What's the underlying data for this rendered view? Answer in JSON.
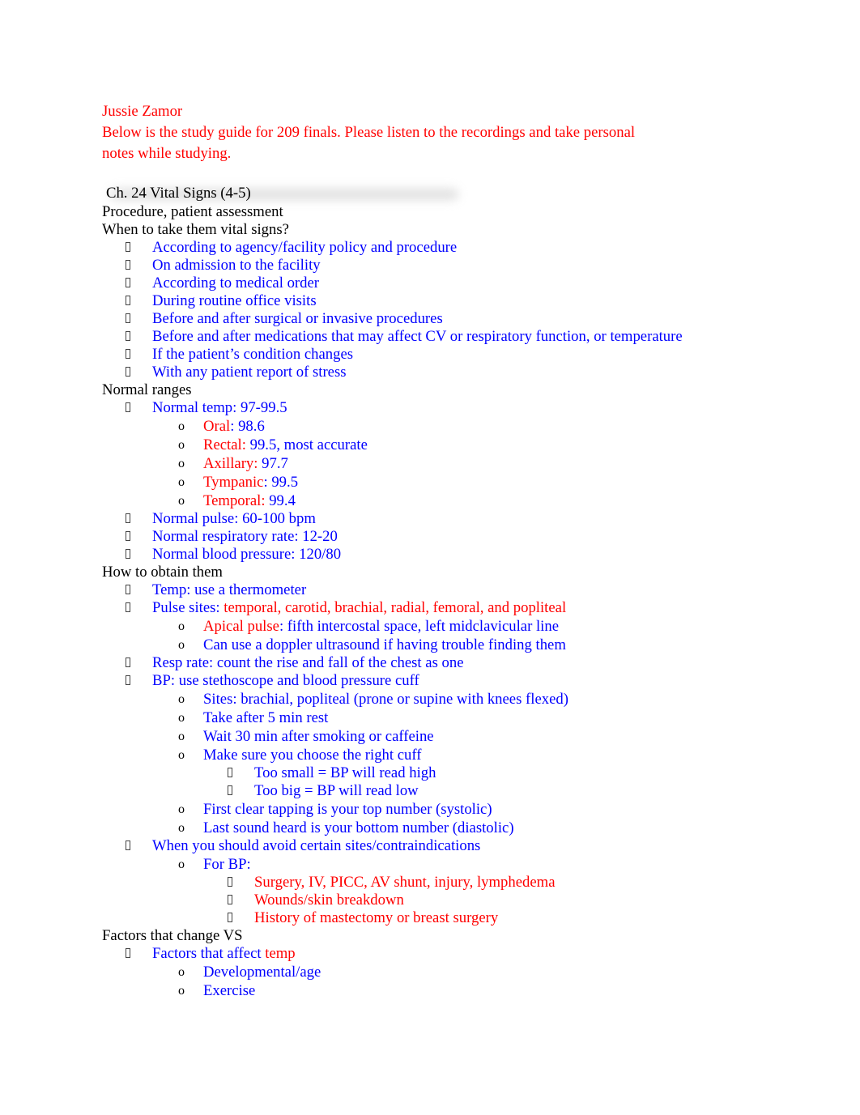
{
  "author": "Jussie Zamor",
  "intro": {
    "line1": "Below is the study guide for 209 finals. Please listen to the recordings and take personal",
    "line2": "notes while studying."
  },
  "colors": {
    "red": "#ff0000",
    "blue": "#0000ff",
    "black": "#000000"
  },
  "bullet_icons": {
    "level1": "missing-glyph-box",
    "level2": "o",
    "level3": "missing-glyph-box"
  },
  "chapter_heading": "Ch. 24 Vital Signs (4-5)",
  "lines": [
    {
      "level": 0,
      "segments": [
        {
          "text": "Procedure, patient assessment",
          "color": "black"
        }
      ]
    },
    {
      "level": 0,
      "segments": [
        {
          "text": "When to take them vital signs?",
          "color": "black"
        }
      ]
    },
    {
      "level": 1,
      "segments": [
        {
          "text": "According to agency/facility policy and procedure",
          "color": "blue"
        }
      ]
    },
    {
      "level": 1,
      "segments": [
        {
          "text": "On admission to the facility",
          "color": "blue"
        }
      ]
    },
    {
      "level": 1,
      "segments": [
        {
          "text": "According to medical order",
          "color": "blue"
        }
      ]
    },
    {
      "level": 1,
      "segments": [
        {
          "text": "During routine office visits",
          "color": "blue"
        }
      ]
    },
    {
      "level": 1,
      "segments": [
        {
          "text": "Before and after surgical or invasive procedures",
          "color": "blue"
        }
      ]
    },
    {
      "level": 1,
      "segments": [
        {
          "text": "Before and after medications that may affect CV or respiratory function, or temperature",
          "color": "blue"
        }
      ]
    },
    {
      "level": 1,
      "segments": [
        {
          "text": "If the patient’s condition changes",
          "color": "blue"
        }
      ]
    },
    {
      "level": 1,
      "segments": [
        {
          "text": "With any patient report of stress",
          "color": "blue"
        }
      ]
    },
    {
      "level": 0,
      "segments": [
        {
          "text": "Normal ranges",
          "color": "black"
        }
      ]
    },
    {
      "level": 1,
      "segments": [
        {
          "text": "Normal temp: 97-99.5",
          "color": "blue"
        }
      ]
    },
    {
      "level": 2,
      "segments": [
        {
          "text": "Oral",
          "color": "red"
        },
        {
          "text": ": 98.6",
          "color": "blue"
        }
      ]
    },
    {
      "level": 2,
      "segments": [
        {
          "text": "Rectal:",
          "color": "red"
        },
        {
          "text": " 99.5, most accurate",
          "color": "blue"
        }
      ]
    },
    {
      "level": 2,
      "segments": [
        {
          "text": "Axillary:",
          "color": "red"
        },
        {
          "text": " 97.7",
          "color": "blue"
        }
      ]
    },
    {
      "level": 2,
      "segments": [
        {
          "text": "Tympanic",
          "color": "red"
        },
        {
          "text": ": 99.5",
          "color": "blue"
        }
      ]
    },
    {
      "level": 2,
      "segments": [
        {
          "text": "Temporal:",
          "color": "red"
        },
        {
          "text": " 99.4",
          "color": "blue"
        }
      ]
    },
    {
      "level": 1,
      "segments": [
        {
          "text": "Normal pulse: 60-100 bpm",
          "color": "blue"
        }
      ]
    },
    {
      "level": 1,
      "segments": [
        {
          "text": "Normal respiratory rate: 12-20",
          "color": "blue"
        }
      ]
    },
    {
      "level": 1,
      "segments": [
        {
          "text": "Normal blood pressure: 120/80",
          "color": "blue"
        }
      ]
    },
    {
      "level": 0,
      "segments": [
        {
          "text": "How to obtain them",
          "color": "black"
        }
      ]
    },
    {
      "level": 1,
      "segments": [
        {
          "text": "Temp: use a thermometer",
          "color": "blue"
        }
      ]
    },
    {
      "level": 1,
      "segments": [
        {
          "text": "Pulse sites: ",
          "color": "blue"
        },
        {
          "text": "temporal, carotid, brachial, radial, femoral, and popliteal",
          "color": "red"
        }
      ]
    },
    {
      "level": 2,
      "segments": [
        {
          "text": "Apical pulse",
          "color": "red"
        },
        {
          "text": ": fifth intercostal space, left midclavicular line",
          "color": "blue"
        }
      ]
    },
    {
      "level": 2,
      "segments": [
        {
          "text": "Can use a doppler ultrasound if having trouble finding them",
          "color": "blue"
        }
      ]
    },
    {
      "level": 1,
      "segments": [
        {
          "text": "Resp rate: count the rise and fall of the chest as one",
          "color": "blue"
        }
      ]
    },
    {
      "level": 1,
      "segments": [
        {
          "text": "BP: use stethoscope and blood pressure cuff",
          "color": "blue"
        }
      ]
    },
    {
      "level": 2,
      "segments": [
        {
          "text": "Sites: brachial, popliteal (prone or supine with knees flexed)",
          "color": "blue"
        }
      ]
    },
    {
      "level": 2,
      "segments": [
        {
          "text": "Take after 5 min rest",
          "color": "blue"
        }
      ]
    },
    {
      "level": 2,
      "segments": [
        {
          "text": "Wait 30 min after smoking or caffeine",
          "color": "blue"
        }
      ]
    },
    {
      "level": 2,
      "segments": [
        {
          "text": "Make sure you choose the right cuff",
          "color": "blue"
        }
      ]
    },
    {
      "level": 3,
      "segments": [
        {
          "text": "Too small = BP will read high",
          "color": "blue"
        }
      ]
    },
    {
      "level": 3,
      "segments": [
        {
          "text": "Too big = BP will read low",
          "color": "blue"
        }
      ]
    },
    {
      "level": 2,
      "segments": [
        {
          "text": "First clear tapping is your top number (systolic)",
          "color": "blue"
        }
      ]
    },
    {
      "level": 2,
      "segments": [
        {
          "text": "Last sound heard is your bottom number (diastolic)",
          "color": "blue"
        }
      ]
    },
    {
      "level": 1,
      "segments": [
        {
          "text": "When you should avoid certain sites/contraindications",
          "color": "blue"
        }
      ]
    },
    {
      "level": 2,
      "segments": [
        {
          "text": "For BP:",
          "color": "blue"
        }
      ]
    },
    {
      "level": 3,
      "segments": [
        {
          "text": "Surgery, IV, PICC, AV shunt, injury, lymphedema",
          "color": "red"
        }
      ]
    },
    {
      "level": 3,
      "segments": [
        {
          "text": "Wounds/skin breakdown",
          "color": "red"
        }
      ]
    },
    {
      "level": 3,
      "segments": [
        {
          "text": "History of mastectomy or breast surgery",
          "color": "red"
        }
      ]
    },
    {
      "level": 0,
      "segments": [
        {
          "text": "Factors that change VS",
          "color": "black"
        }
      ]
    },
    {
      "level": 1,
      "segments": [
        {
          "text": "Factors that affect ",
          "color": "blue"
        },
        {
          "text": "temp",
          "color": "red"
        }
      ]
    },
    {
      "level": 2,
      "segments": [
        {
          "text": "Developmental/age",
          "color": "blue"
        }
      ]
    },
    {
      "level": 2,
      "segments": [
        {
          "text": "Exercise",
          "color": "blue"
        }
      ]
    }
  ]
}
